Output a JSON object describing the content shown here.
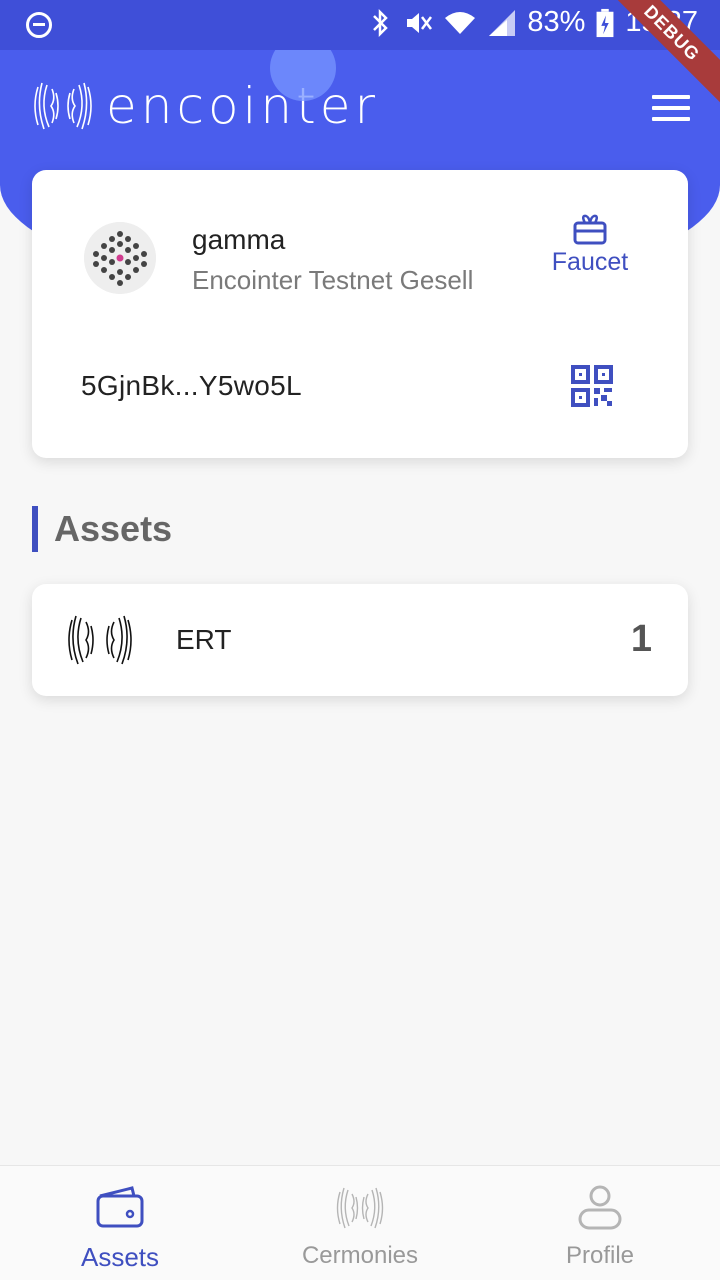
{
  "status_bar": {
    "battery": "83%",
    "time": "15:37",
    "debug_label": "DEBUG"
  },
  "header": {
    "app_name": "encointer",
    "menu_icon": "hamburger-menu-icon"
  },
  "account_card": {
    "name": "gamma",
    "community": "Encointer Testnet Gesell",
    "faucet_label": "Faucet",
    "faucet_icon": "gift-card-icon",
    "address": "5GjnBk...Y5wo5L",
    "qr_icon": "qr-code-icon"
  },
  "assets_section": {
    "title": "Assets",
    "items": [
      {
        "symbol": "ERT",
        "balance": "1",
        "icon": "encointer-logo-icon"
      }
    ]
  },
  "bottom_nav": {
    "items": [
      {
        "label": "Assets",
        "icon": "wallet-icon",
        "active": true
      },
      {
        "label": "Cermonies",
        "icon": "encointer-logo-icon",
        "active": false
      },
      {
        "label": "Profile",
        "icon": "person-icon",
        "active": false
      }
    ]
  },
  "colors": {
    "primary": "#4a5ded",
    "accent": "#3f4fc0",
    "status_bar": "#3f4fd8",
    "debug_ribbon": "#a83b3b"
  }
}
